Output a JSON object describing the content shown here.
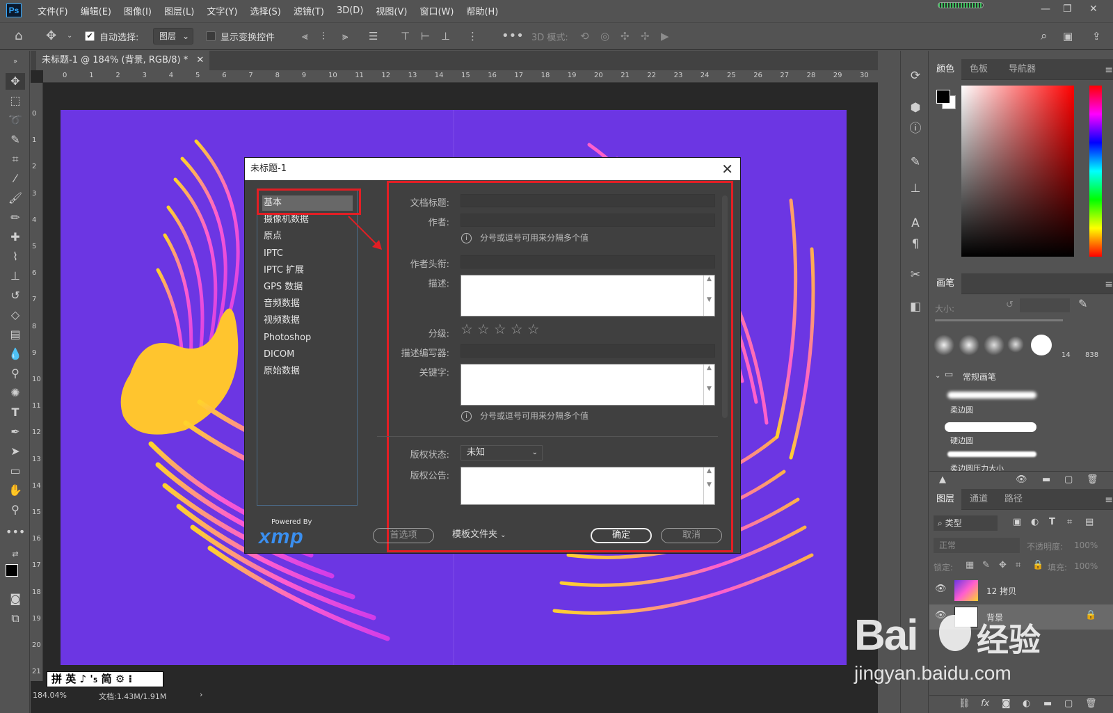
{
  "menu": {
    "logo": "Ps",
    "items": [
      "文件(F)",
      "编辑(E)",
      "图像(I)",
      "图层(L)",
      "文字(Y)",
      "选择(S)",
      "滤镜(T)",
      "3D(D)",
      "视图(V)",
      "窗口(W)",
      "帮助(H)"
    ]
  },
  "options": {
    "auto_select_label": "自动选择:",
    "auto_select_value": "图层",
    "show_transform_label": "显示变换控件",
    "mode_3d_label": "3D 模式:"
  },
  "document": {
    "tab_title": "未标题-1 @ 184% (背景, RGB/8) *",
    "zoom": "184.04%",
    "doc_size": "文档:1.43M/1.91M",
    "ime_text": "拼 英 ♪ '₅ 简 ⚙ ⁝",
    "canvas_color": "#6c36e3"
  },
  "rulers": {
    "top": [
      "0",
      "1",
      "2",
      "3",
      "4",
      "5",
      "6",
      "7",
      "8",
      "9",
      "10",
      "11",
      "12",
      "13",
      "14",
      "15",
      "16",
      "17",
      "18",
      "19",
      "20",
      "21",
      "22",
      "23",
      "24",
      "25",
      "26",
      "27",
      "28",
      "29",
      "30"
    ],
    "left": [
      "0",
      "1",
      "2",
      "3",
      "4",
      "5",
      "6",
      "7",
      "8",
      "9",
      "10",
      "11",
      "12",
      "13",
      "14",
      "15",
      "16",
      "17",
      "18",
      "19",
      "20",
      "21"
    ]
  },
  "dialog": {
    "title": "未标题-1",
    "categories": [
      "基本",
      "摄像机数据",
      "原点",
      "IPTC",
      "IPTC 扩展",
      "GPS 数据",
      "音频数据",
      "视频数据",
      "Photoshop",
      "DICOM",
      "原始数据"
    ],
    "selected_category": "基本",
    "fields": {
      "doc_title_label": "文档标题:",
      "author_label": "作者:",
      "author_hint": "分号或逗号可用来分隔多个值",
      "author_title_label": "作者头衔:",
      "desc_label": "描述:",
      "rating_label": "分级:",
      "desc_writer_label": "描述编写器:",
      "keywords_label": "关键字:",
      "keywords_hint": "分号或逗号可用来分隔多个值",
      "copyright_status_label": "版权状态:",
      "copyright_status_value": "未知",
      "copyright_notice_label": "版权公告:"
    },
    "powered_by": "Powered By",
    "xmp": "xmp",
    "buttons": {
      "prefs": "首选项",
      "template": "模板文件夹",
      "ok": "确定",
      "cancel": "取消"
    },
    "rating_stars": 0
  },
  "right": {
    "color_tabs": [
      "颜色",
      "色板",
      "导航器"
    ],
    "brush_title": "画笔",
    "size_label": "大小:",
    "brush_sizes": [
      "14",
      "838"
    ],
    "brush_group": "常规画笔",
    "brushes": [
      "柔边圆",
      "硬边圆",
      "柔边圆压力大小"
    ],
    "layer_tabs": [
      "图层",
      "通道",
      "路径"
    ],
    "kind_label": "类型",
    "blend": "正常",
    "opacity_label": "不透明度:",
    "opacity": "100%",
    "lock_label": "锁定:",
    "fill_label": "填充:",
    "fill": "100%",
    "layers": [
      {
        "name": "12 拷贝"
      },
      {
        "name": "背景"
      }
    ]
  },
  "watermark": {
    "brand": "Bai",
    "brand2": "经验",
    "url": "jingyan.baidu.com"
  }
}
